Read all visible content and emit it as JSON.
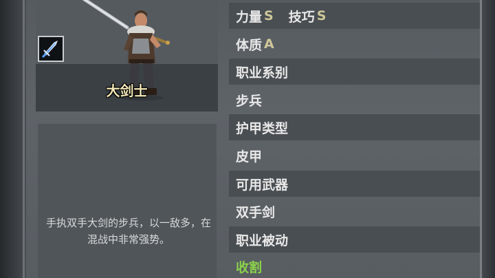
{
  "portrait": {
    "class_name": "大剑士"
  },
  "description": "手执双手大剑的步兵，以一敌多，在混战中非常强势。",
  "stats": {
    "strength_label": "力量",
    "strength_grade": "S",
    "skill_label": "技巧",
    "skill_grade": "S",
    "constitution_label": "体质",
    "constitution_grade": "A"
  },
  "rows": {
    "class_type_label": "职业系别",
    "class_type_value": "步兵",
    "armor_type_label": "护甲类型",
    "armor_type_value": "皮甲",
    "weapons_label": "可用武器",
    "weapons_value": "双手剑",
    "passive_label": "职业被动",
    "passive_value": "收割"
  },
  "colors": {
    "grade": "#cfc79a",
    "passive_value": "#8ad14a",
    "class_name": "#f3e7b8"
  },
  "icons": {
    "class_icon": "sword-icon"
  }
}
